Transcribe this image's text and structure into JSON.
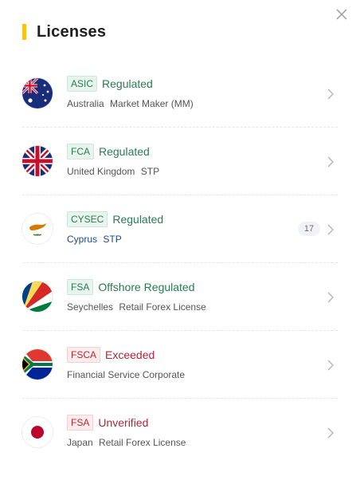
{
  "panel": {
    "title": "Licenses",
    "close_icon": "close-icon"
  },
  "licenses": [
    {
      "flag": "australia-flag-icon",
      "badge": "ASIC",
      "status": "Regulated",
      "status_tone": "green",
      "country": "Australia",
      "license_type": "Market Maker (MM)"
    },
    {
      "flag": "united-kingdom-flag-icon",
      "badge": "FCA",
      "status": "Regulated",
      "status_tone": "green",
      "country": "United Kingdom",
      "license_type": "STP"
    },
    {
      "flag": "cyprus-flag-icon",
      "badge": "CYSEC",
      "status": "Regulated",
      "status_tone": "green",
      "country": "Cyprus",
      "license_type": "STP",
      "count": "17"
    },
    {
      "flag": "seychelles-flag-icon",
      "badge": "FSA",
      "status": "Offshore Regulated",
      "status_tone": "green",
      "country": "Seychelles",
      "license_type": "Retail Forex License"
    },
    {
      "flag": "south-africa-flag-icon",
      "badge": "FSCA",
      "status": "Exceeded",
      "status_tone": "red",
      "country": "Financial Service Corporate",
      "license_type": ""
    },
    {
      "flag": "japan-flag-icon",
      "badge": "FSA",
      "status": "Unverified",
      "status_tone": "red",
      "country": "Japan",
      "license_type": "Retail Forex License"
    }
  ],
  "colors": {
    "accent_bar": "#f5c518",
    "regulated_green": "#2b7a57",
    "warning_red": "#b3263a",
    "link_blue": "#1d4a8a"
  }
}
